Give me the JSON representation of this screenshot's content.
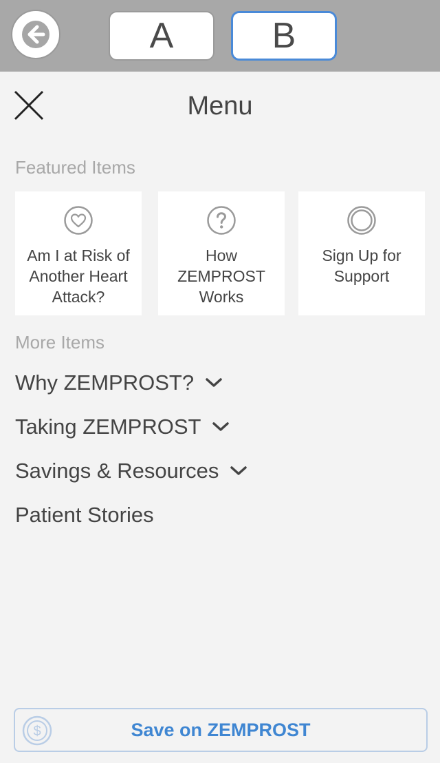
{
  "topbar": {
    "variant_a_label": "A",
    "variant_b_label": "B",
    "back_icon": "arrow-left-icon",
    "selected_variant": "B",
    "accent_color": "#4a8ad8"
  },
  "header": {
    "title": "Menu",
    "close_icon": "close-icon"
  },
  "featured": {
    "label": "Featured Items",
    "items": [
      {
        "label": "Am I at Risk of Another Heart Attack?",
        "icon": "heart-icon"
      },
      {
        "label": "How ZEMPROST Works",
        "icon": "question-icon"
      },
      {
        "label": "Sign Up for Support",
        "icon": "ring-icon"
      }
    ]
  },
  "more": {
    "label": "More Items",
    "items": [
      {
        "label": "Why ZEMPROST?",
        "expandable": true
      },
      {
        "label": "Taking ZEMPROST",
        "expandable": true
      },
      {
        "label": "Savings & Resources",
        "expandable": true
      },
      {
        "label": "Patient Stories",
        "expandable": false
      }
    ]
  },
  "footer": {
    "save_label": "Save on ZEMPROST",
    "save_icon": "dollar-coin-icon",
    "save_color": "#3f86d2"
  }
}
